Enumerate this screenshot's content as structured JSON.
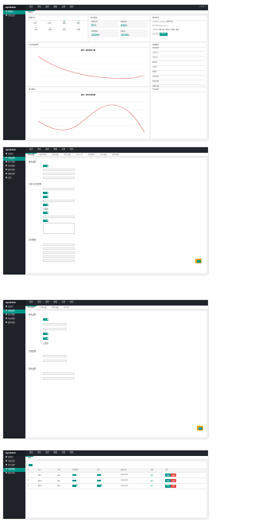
{
  "app": {
    "brand": "layuiAdmin"
  },
  "topnav": [
    "首页",
    "系统",
    "插件",
    "模板",
    "应用",
    "帮助"
  ],
  "top_icons": [
    "⌕",
    "✉",
    "⚙",
    "≡"
  ],
  "sidebar": [
    {
      "label": "控制台"
    },
    {
      "label": "系统设置"
    },
    {
      "label": "用户管理"
    },
    {
      "label": "内容管理"
    },
    {
      "label": "插件管理"
    },
    {
      "label": "模板管理"
    },
    {
      "label": "其他"
    }
  ],
  "screen1": {
    "tab": "控制台",
    "quick_title": "快捷方式",
    "quick_items": [
      "主页一",
      "主页二",
      "弹层",
      "聊天",
      "工具",
      "设置",
      "消息",
      "授权"
    ],
    "stats_title": "待办事项",
    "stats": [
      {
        "label": "待审评论",
        "value": "97",
        "unit": "条"
      },
      {
        "label": "待审帖子",
        "value": "440",
        "unit": "条"
      },
      {
        "label": "待审商品",
        "value": "1320",
        "unit": "件"
      },
      {
        "label": "待发货",
        "value": "1200",
        "unit": "单"
      }
    ],
    "info_title": "版本信息",
    "info_rows": [
      {
        "k": "当前版本",
        "v": "v1.0.0 pro 更新日志"
      },
      {
        "k": "基于框架",
        "v": "layui-v2.2.5"
      },
      {
        "k": "主要特色",
        "v": "零门槛 / 响应式 / 清爽 / 极简"
      },
      {
        "k": "获取渠道",
        "v": "获取授权"
      }
    ],
    "chart1_title": "今日流量趋势",
    "chart1_heading": "最新一周新增用户量",
    "chart2_title": "用户留言",
    "chart2_heading": "最新一周美食销售量",
    "effect_title": "效果报告",
    "effect_rows": [
      {
        "k": "转化时间",
        "v": ""
      },
      {
        "k": "今日UV",
        "v": ""
      },
      {
        "k": "今日PV",
        "v": ""
      },
      {
        "k": "跳出率",
        "v": ""
      },
      {
        "k": "今日IP",
        "v": ""
      },
      {
        "k": "新用户",
        "v": ""
      },
      {
        "k": "访问时长",
        "v": ""
      },
      {
        "k": "实时访客",
        "v": ""
      },
      {
        "k": "在线人数",
        "v": ""
      }
    ],
    "notice_title": "产品动态"
  },
  "screen2": {
    "tabs": [
      "网站设置",
      "邮件服务",
      "安全设置",
      "用户设置",
      "文件上传",
      "短信服务",
      "支付设置",
      "其他设置"
    ],
    "section1": "基本设置",
    "section2": "注册与访问控制",
    "section3": "访问限制"
  },
  "screen3": {
    "tabs": [
      "用户管理",
      "注册设置",
      "登录设置",
      "用户组"
    ],
    "section1": "基本设置",
    "section2": "注册设置",
    "section3": "登录设置"
  },
  "screen4": {
    "tab": "列表",
    "headers": [
      "ID",
      "名称",
      "状态",
      "是否推荐",
      "排序",
      "更新时间",
      "审核",
      "操作"
    ],
    "rows": [
      {
        "id": "1",
        "name": "栏目一",
        "flag": "默认",
        "time": "2018-02-21",
        "status": "通过"
      },
      {
        "id": "2",
        "name": "栏目二",
        "flag": "默认",
        "time": "2018-02-21",
        "status": "通过"
      },
      {
        "id": "3",
        "name": "栏目三",
        "flag": "默认",
        "time": "2018-02-21",
        "status": "通过"
      }
    ],
    "edit": "编辑",
    "del": "删除"
  }
}
